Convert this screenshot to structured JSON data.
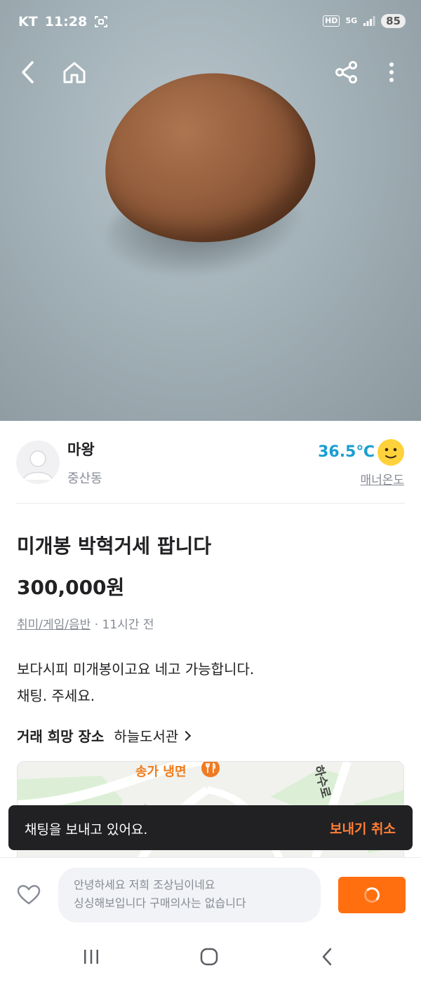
{
  "status_bar": {
    "carrier": "KT",
    "time": "11:28",
    "hd": "HD",
    "network": "5G",
    "battery": "85"
  },
  "seller": {
    "name": "마왕",
    "area": "중산동",
    "temperature": "36.5℃",
    "temperature_label": "매너온도",
    "temperature_color": "#1a9ed1"
  },
  "product": {
    "title": "미개봉 박혁거세 팝니다",
    "price": "300,000원",
    "category": "취미/게임/음반",
    "separator": " · ",
    "posted": "11시간 전",
    "description": [
      "보다시피 미개봉이고요 네고 가능합니다.",
      "채팅. 주세요."
    ]
  },
  "trade_place": {
    "label": "거래 희망 장소",
    "value": "하늘도서관"
  },
  "map": {
    "poi_label": "송가 냉면",
    "road_label": "하수로"
  },
  "toast": {
    "message": "채팅을 보내고 있어요.",
    "action": "보내기 취소",
    "action_color": "#ff7e36"
  },
  "chat": {
    "lines": [
      "안녕하세요 저희 조상님이네요",
      "싱싱해보입니다 구매의사는 없습니다"
    ]
  },
  "colors": {
    "brand": "#ff6f0f",
    "toast_bg": "#212124"
  }
}
